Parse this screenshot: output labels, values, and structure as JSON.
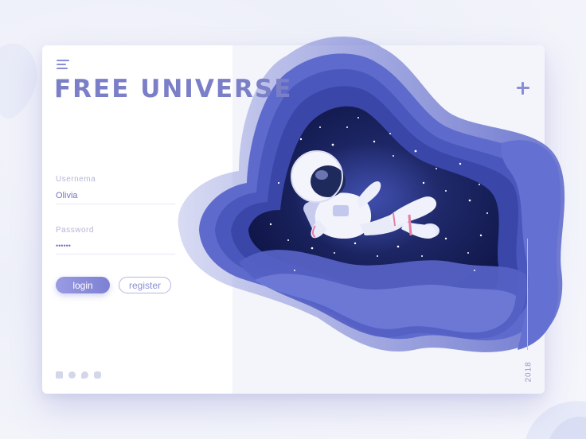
{
  "header": {
    "title": "FREE UNIVERSE"
  },
  "login_form": {
    "username_label": "Usernema",
    "username_value": "Olivia",
    "password_label": "Password",
    "password_value": "••••••",
    "login_label": "login",
    "register_label": "register"
  },
  "footer": {
    "socials": [
      "facebook-icon",
      "dribbble-icon",
      "twitter-icon",
      "instagram-icon"
    ],
    "year": "2018"
  },
  "colors": {
    "accent": "#7b7fc8",
    "space_dark": "#141b4d",
    "wave_blue": "#5561c4",
    "card_bg": "#ffffff"
  }
}
